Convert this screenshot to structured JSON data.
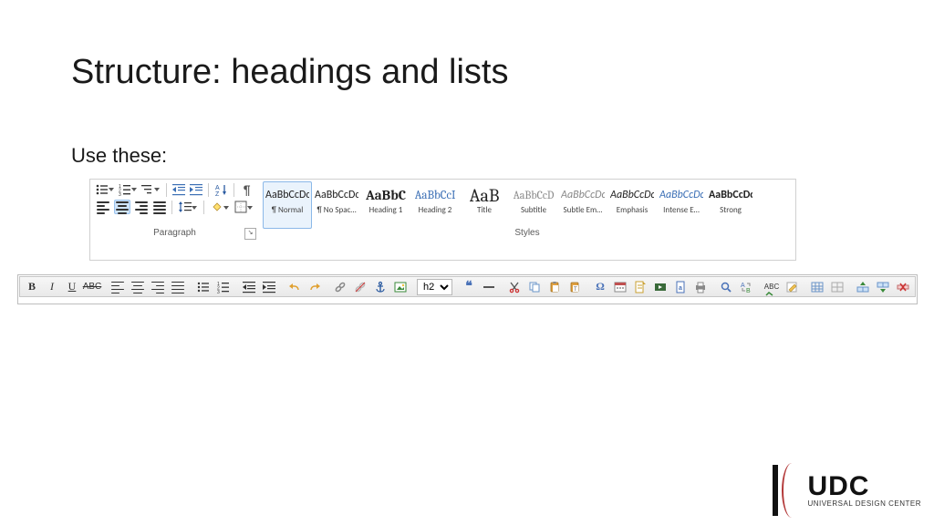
{
  "slide": {
    "title": "Structure: headings and lists",
    "subtitle": "Use these:"
  },
  "word_ribbon": {
    "paragraph": {
      "group_label": "Paragraph"
    },
    "styles": {
      "group_label": "Styles",
      "tiles": [
        {
          "sample": "AaBbCcDc",
          "label": "¶ Normal",
          "selected": true,
          "font_weight": "400",
          "font_size": "12px",
          "font_family": "Calibri, sans-serif",
          "italic": false,
          "color": "#222"
        },
        {
          "sample": "AaBbCcDc",
          "label": "¶ No Spac…",
          "selected": false,
          "font_weight": "400",
          "font_size": "12px",
          "font_family": "Calibri, sans-serif",
          "italic": false,
          "color": "#222"
        },
        {
          "sample": "AaBbC",
          "label": "Heading 1",
          "selected": false,
          "font_weight": "700",
          "font_size": "15px",
          "font_family": "'Cambria', serif",
          "italic": false,
          "color": "#222"
        },
        {
          "sample": "AaBbCcI",
          "label": "Heading 2",
          "selected": false,
          "font_weight": "400",
          "font_size": "13px",
          "font_family": "'Cambria', serif",
          "italic": false,
          "color": "#3b6fb5"
        },
        {
          "sample": "AaB",
          "label": "Title",
          "selected": false,
          "font_weight": "400",
          "font_size": "20px",
          "font_family": "'Cambria', serif",
          "italic": false,
          "color": "#222"
        },
        {
          "sample": "AaBbCcD",
          "label": "Subtitle",
          "selected": false,
          "font_weight": "400",
          "font_size": "12px",
          "font_family": "'Cambria', serif",
          "italic": false,
          "color": "#888"
        },
        {
          "sample": "AaBbCcDc",
          "label": "Subtle Em…",
          "selected": false,
          "font_weight": "400",
          "font_size": "12px",
          "font_family": "Calibri, sans-serif",
          "italic": true,
          "color": "#888"
        },
        {
          "sample": "AaBbCcDc",
          "label": "Emphasis",
          "selected": false,
          "font_weight": "400",
          "font_size": "12px",
          "font_family": "Calibri, sans-serif",
          "italic": true,
          "color": "#222"
        },
        {
          "sample": "AaBbCcDc",
          "label": "Intense E…",
          "selected": false,
          "font_weight": "400",
          "font_size": "12px",
          "font_family": "Calibri, sans-serif",
          "italic": true,
          "color": "#3b6fb5"
        },
        {
          "sample": "AaBbCcDc",
          "label": "Strong",
          "selected": false,
          "font_weight": "700",
          "font_size": "12px",
          "font_family": "Calibri, sans-serif",
          "italic": false,
          "color": "#222"
        }
      ]
    }
  },
  "editor_toolbar": {
    "format_value": "h2"
  },
  "logo": {
    "abbr": "UDC",
    "full": "UNIVERSAL DESIGN CENTER"
  }
}
